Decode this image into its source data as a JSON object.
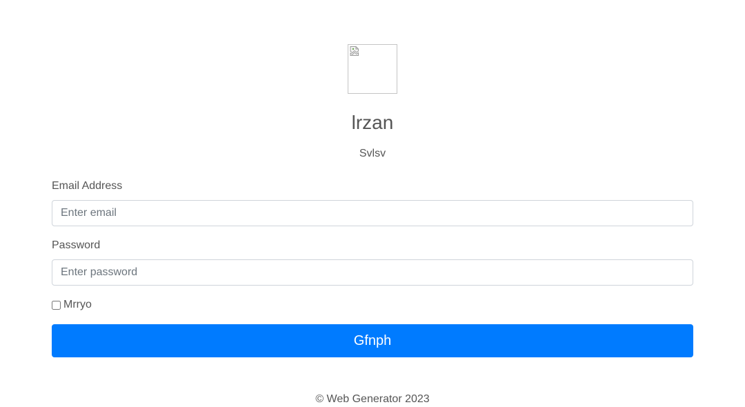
{
  "header": {
    "logo_icon": "broken-image-icon",
    "title": "lrzan",
    "subtitle": "Svlsv"
  },
  "form": {
    "email": {
      "label": "Email Address",
      "placeholder": "Enter email",
      "value": ""
    },
    "password": {
      "label": "Password",
      "placeholder": "Enter password",
      "value": ""
    },
    "remember": {
      "label": "Mrryo",
      "checked": false
    },
    "submit_label": "Gfnph"
  },
  "footer": {
    "text": "© Web Generator 2023"
  },
  "colors": {
    "primary": "#007bff",
    "text": "#555555",
    "input_border": "#cfd4da"
  }
}
